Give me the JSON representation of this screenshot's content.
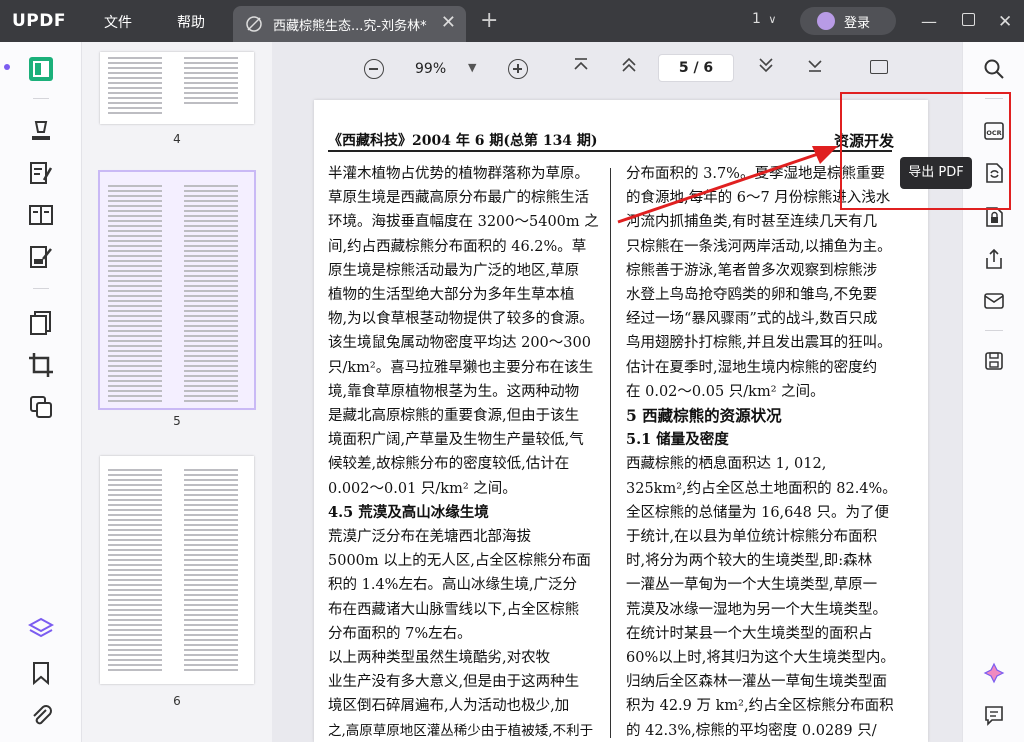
{
  "app": {
    "logo": "UPDF",
    "menu": [
      "文件",
      "帮助"
    ]
  },
  "tab": {
    "title": "西藏棕熊生态...究-刘务林*",
    "close": "✕",
    "add": "+"
  },
  "titlebar_right": {
    "version_label": "1",
    "login_label": "登录"
  },
  "toolbar": {
    "zoom_value": "99%",
    "page_indicator": "5 / 6"
  },
  "thumbnails": [
    {
      "label": "4"
    },
    {
      "label": "5"
    },
    {
      "label": "6"
    }
  ],
  "tooltip": "导出 PDF",
  "document": {
    "header_left": "《西藏科技》2004 年 6 期(总第 134 期)",
    "header_right": "资源开发",
    "left_column": [
      "半灌木植物占优势的植物群落称为草原。",
      "草原生境是西藏高原分布最广的棕熊生活",
      "环境。海拔垂直幅度在 3200～5400m 之",
      "间,约占西藏棕熊分布面积的 46.2%。草",
      "原生境是棕熊活动最为广泛的地区,草原",
      "植物的生活型绝大部分为多年生草本植",
      "物,为以食草根茎动物提供了较多的食源。",
      "该生境鼠兔属动物密度平均达 200～300",
      "只/km²。喜马拉雅旱獭也主要分布在该生",
      "境,靠食草原植物根茎为生。这两种动物",
      "是藏北高原棕熊的重要食源,但由于该生",
      "境面积广阔,产草量及生物生产量较低,气",
      "候较差,故棕熊分布的密度较低,估计在",
      "0.002～0.01 只/km² 之间。",
      "4.5    荒漠及高山冰缘生境",
      "    荒漠广泛分布在羌塘西北部海拔",
      "5000m 以上的无人区,占全区棕熊分布面",
      "积的 1.4%左右。高山冰缘生境,广泛分",
      "布在西藏诸大山脉雪线以下,占全区棕熊",
      "分布面积的 7%左右。",
      "    以上两种类型虽然生境酷劣,对农牧",
      "业生产没有多大意义,但是由于这两种生",
      "境区倒石碎屑遍布,人为活动也极少,加",
      "之,高原草原地区灌丛稀少由于植被矮,不利于"
    ],
    "right_column": [
      "分布面积的 3.7%。夏季湿地是棕熊重要",
      "的食源地,每年的 6～7 月份棕熊进入浅水",
      "河流内抓捕鱼类,有时甚至连续几天有几",
      "只棕熊在一条浅河两岸活动,以捕鱼为主。",
      "棕熊善于游泳,笔者曾多次观察到棕熊涉",
      "水登上鸟岛抢夺鸥类的卵和雏鸟,不免要",
      "经过一场“暴风骤雨”式的战斗,数百只成",
      "鸟用翅膀扑打棕熊,并且发出震耳的狂叫。",
      "估计在夏季时,湿地生境内棕熊的密度约",
      "在 0.02～0.05 只/km² 之间。",
      "5    西藏棕熊的资源状况",
      "5.1    储量及密度",
      "    西藏棕熊的栖息面积达 1, 012,",
      "325km²,约占全区总土地面积的 82.4%。",
      "全区棕熊的总储量为 16,648 只。为了便",
      "于统计,在以县为单位统计棕熊分布面积",
      "时,将分为两个较大的生境类型,即:森林",
      "一灌丛一草甸为一个大生境类型,草原一",
      "荒漠及冰缘一湿地为另一个大生境类型。",
      "在统计时某县一个大生境类型的面积占",
      "60%以上时,将其归为这个大生境类型内。",
      "归纳后全区森林一灌丛一草甸生境类型面",
      "积为 42.9 万 km²,约占全区棕熊分布面积",
      "的 42.3%,棕熊的平均密度 0.0289 只/"
    ]
  },
  "colors": {
    "accent": "#7b5cf0",
    "highlight": "#e02020",
    "titlebar": "#3a3b3f"
  }
}
